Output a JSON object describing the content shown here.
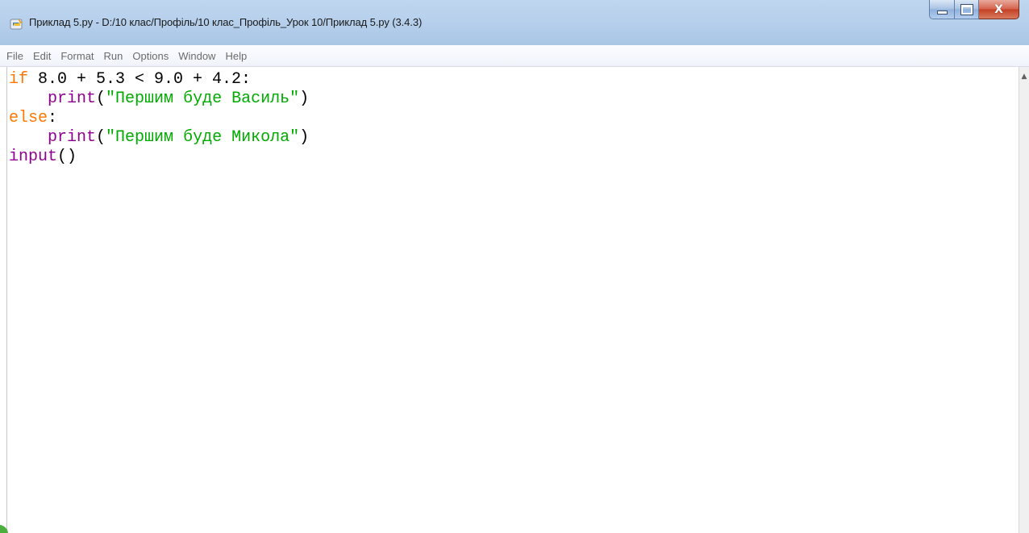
{
  "window": {
    "title": "Приклад 5.py - D:/10 клас/Профіль/10 клас_Профіль_Урок 10/Приклад 5.py (3.4.3)",
    "icon": "python-idle-icon",
    "buttons": {
      "minimize_icon": "minimize-icon",
      "maximize_icon": "maximize-icon",
      "close_label": "X"
    }
  },
  "menu": {
    "items": [
      {
        "label": "File"
      },
      {
        "label": "Edit"
      },
      {
        "label": "Format"
      },
      {
        "label": "Run"
      },
      {
        "label": "Options"
      },
      {
        "label": "Window"
      },
      {
        "label": "Help"
      }
    ]
  },
  "editor": {
    "lines": [
      [
        {
          "t": "if",
          "c": "kw"
        },
        {
          "t": " 8.0 + 5.3 < 9.0 + 4.2:",
          "c": ""
        }
      ],
      [
        {
          "t": "    ",
          "c": ""
        },
        {
          "t": "print",
          "c": "bi"
        },
        {
          "t": "(",
          "c": ""
        },
        {
          "t": "\"Першим буде Василь\"",
          "c": "st"
        },
        {
          "t": ")",
          "c": ""
        }
      ],
      [
        {
          "t": "else",
          "c": "kw"
        },
        {
          "t": ":",
          "c": ""
        }
      ],
      [
        {
          "t": "    ",
          "c": ""
        },
        {
          "t": "print",
          "c": "bi"
        },
        {
          "t": "(",
          "c": ""
        },
        {
          "t": "\"Першим буде Микола\"",
          "c": "st"
        },
        {
          "t": ")",
          "c": ""
        }
      ],
      [
        {
          "t": "input",
          "c": "bi"
        },
        {
          "t": "()",
          "c": ""
        }
      ]
    ]
  },
  "colors": {
    "keyword": "#ff7700",
    "builtin": "#900090",
    "string": "#00aa00",
    "titlebar": "#b7d0ec",
    "close_button": "#c23f24"
  }
}
